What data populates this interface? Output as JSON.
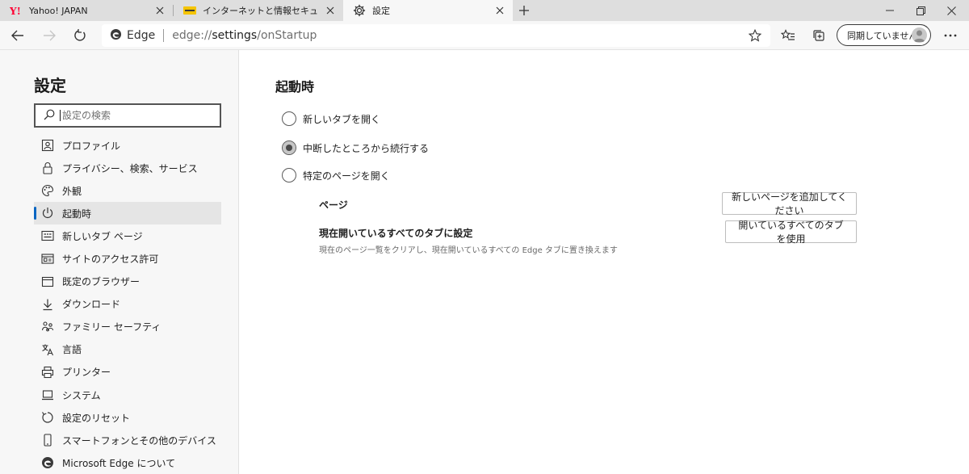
{
  "tabs": [
    {
      "title": "Yahoo! JAPAN",
      "favicon": "yahoo-favicon"
    },
    {
      "title": "インターネットと情報セキュリティの最新",
      "favicon": "site-favicon"
    },
    {
      "title": "設定",
      "favicon": "gear-icon",
      "active": true
    }
  ],
  "address_bar": {
    "brand": "Edge",
    "url_prefix": "edge://",
    "url_main": "settings",
    "url_suffix": "/onStartup"
  },
  "profile": {
    "label": "同期していません"
  },
  "sidebar": {
    "title": "設定",
    "search_placeholder": "設定の検索",
    "items": [
      {
        "label": "プロファイル",
        "icon": "profile-icon"
      },
      {
        "label": "プライバシー、検索、サービス",
        "icon": "lock-icon"
      },
      {
        "label": "外観",
        "icon": "palette-icon"
      },
      {
        "label": "起動時",
        "icon": "power-icon",
        "selected": true
      },
      {
        "label": "新しいタブ ページ",
        "icon": "new-tab-page-icon"
      },
      {
        "label": "サイトのアクセス許可",
        "icon": "site-permissions-icon"
      },
      {
        "label": "既定のブラウザー",
        "icon": "browser-icon"
      },
      {
        "label": "ダウンロード",
        "icon": "download-icon"
      },
      {
        "label": "ファミリー セーフティ",
        "icon": "family-icon"
      },
      {
        "label": "言語",
        "icon": "language-icon"
      },
      {
        "label": "プリンター",
        "icon": "printer-icon"
      },
      {
        "label": "システム",
        "icon": "system-icon"
      },
      {
        "label": "設定のリセット",
        "icon": "reset-icon"
      },
      {
        "label": "スマートフォンとその他のデバイス",
        "icon": "phone-icon"
      },
      {
        "label": "Microsoft Edge について",
        "icon": "edge-icon"
      }
    ]
  },
  "main": {
    "title": "起動時",
    "options": [
      {
        "label": "新しいタブを開く",
        "checked": false
      },
      {
        "label": "中断したところから続行する",
        "checked": true
      },
      {
        "label": "特定のページを開く",
        "checked": false
      }
    ],
    "pages_label": "ページ",
    "add_page_button": "新しいページを追加してください",
    "set_current_label": "現在開いているすべてのタブに設定",
    "set_current_desc": "現在のページ一覧をクリアし、現在開いているすべての Edge タブに置き換えます",
    "use_open_tabs_button": "開いているすべてのタブを使用"
  },
  "colors": {
    "accent": "#0a66c2",
    "sidebar_bg": "#f7f7f7",
    "tabstrip_bg": "#dedede"
  }
}
